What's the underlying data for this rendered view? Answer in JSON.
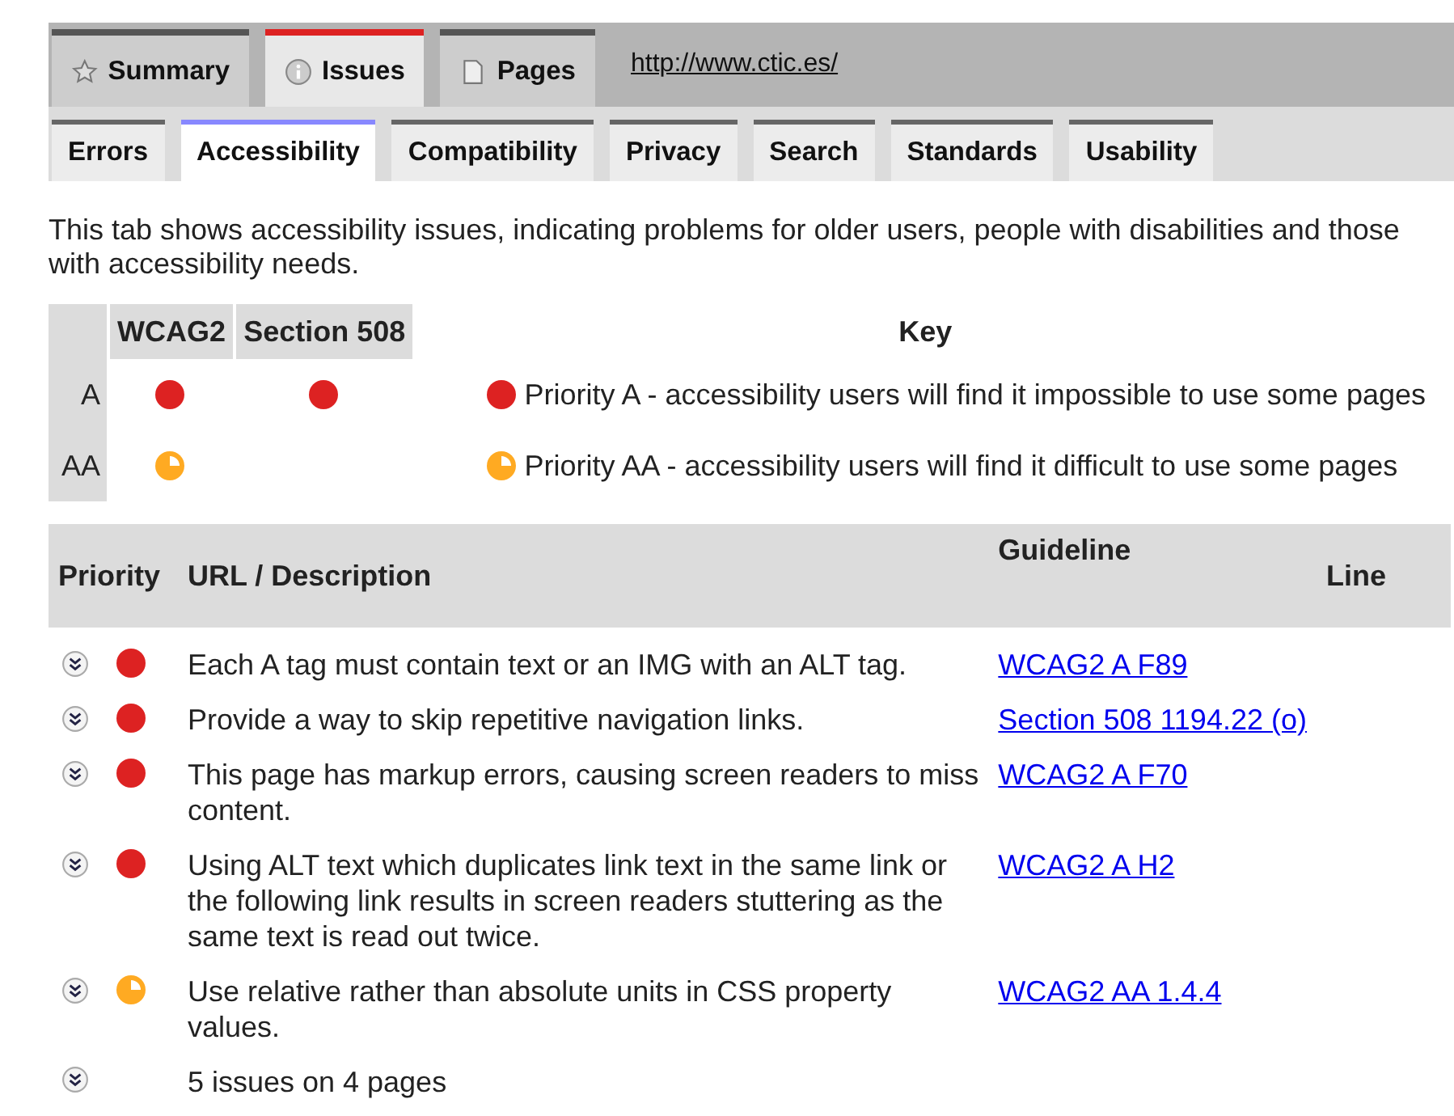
{
  "main_tabs": [
    {
      "label": "Summary",
      "selected": false
    },
    {
      "label": "Issues",
      "selected": true
    },
    {
      "label": "Pages",
      "selected": false
    }
  ],
  "site_link": "http://www.ctic.es/",
  "sub_tabs": [
    {
      "label": "Errors",
      "selected": false
    },
    {
      "label": "Accessibility",
      "selected": true
    },
    {
      "label": "Compatibility",
      "selected": false
    },
    {
      "label": "Privacy",
      "selected": false
    },
    {
      "label": "Search",
      "selected": false
    },
    {
      "label": "Standards",
      "selected": false
    },
    {
      "label": "Usability",
      "selected": false
    }
  ],
  "intro": "This tab shows accessibility issues, indicating problems for older users, people with disabilities and those with accessibility needs.",
  "key_table": {
    "columns": [
      "WCAG2",
      "Section 508"
    ],
    "key_heading": "Key",
    "rows": [
      {
        "label": "A",
        "marks": [
          {
            "kind": "a"
          },
          {
            "kind": "a"
          }
        ],
        "kind": "a",
        "key_text": "Priority A - accessibility users will find it impossible to use some pages"
      },
      {
        "label": "AA",
        "marks": [
          {
            "kind": "aa"
          }
        ],
        "kind": "aa",
        "key_text": "Priority AA - accessibility users will find it difficult to use some pages"
      }
    ]
  },
  "issues_table": {
    "columns": [
      "Priority",
      "URL / Description",
      "Guideline",
      "Line"
    ],
    "rows": [
      {
        "kind": "a",
        "description": "Each A tag must contain text or an IMG with an ALT tag.",
        "guideline": "WCAG2 A F89"
      },
      {
        "kind": "a",
        "description": "Provide a way to skip repetitive navigation links.",
        "guideline": "Section 508 1194.22 (o)"
      },
      {
        "kind": "a",
        "description": "This page has markup errors, causing screen readers to miss content.",
        "guideline": "WCAG2 A F70"
      },
      {
        "kind": "a",
        "description": "Using ALT text which duplicates link text in the same link or the following link results in screen readers stuttering as the same text is read out twice.",
        "guideline": "WCAG2 A H2"
      },
      {
        "kind": "aa",
        "description": "Use relative rather than absolute units in CSS property values.",
        "guideline": "WCAG2 AA 1.4.4"
      }
    ],
    "summary": "5 issues on 4 pages"
  }
}
